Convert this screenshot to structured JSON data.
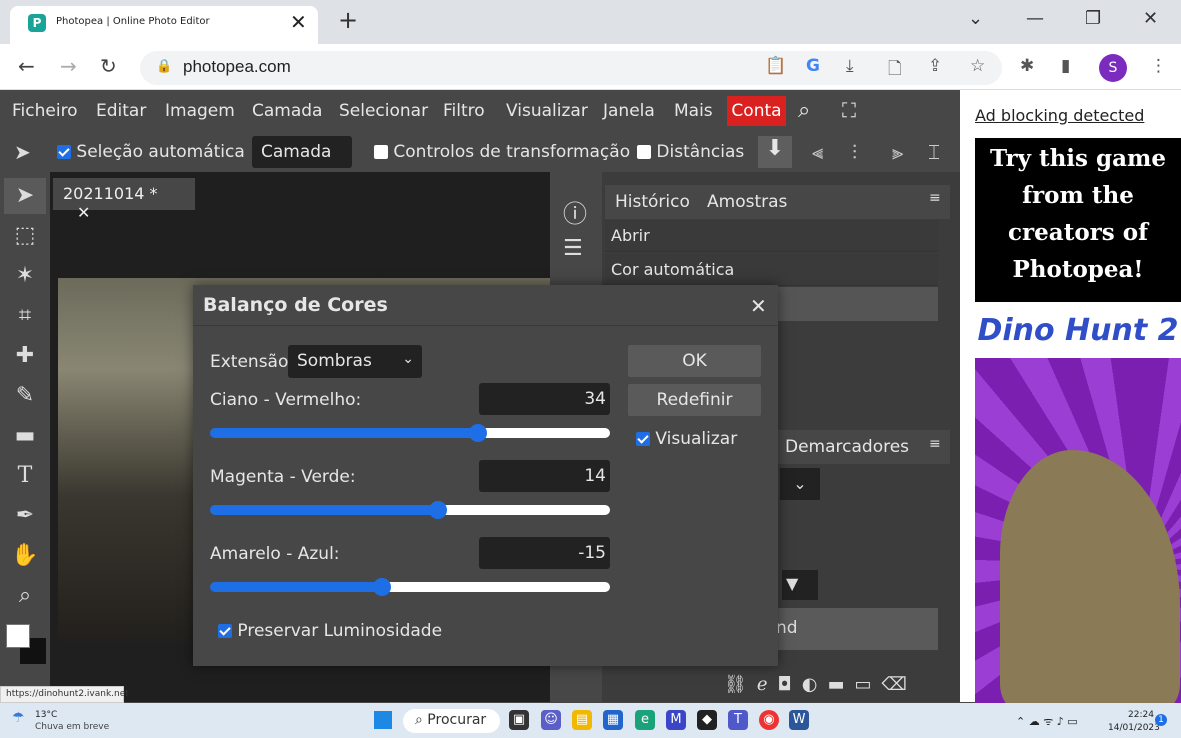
{
  "browser": {
    "tab_title": "Photopea | Online Photo Editor",
    "url": "photopea.com",
    "avatar_letter": "S"
  },
  "menu": {
    "items": [
      "Ficheiro",
      "Editar",
      "Imagem",
      "Camada",
      "Selecionar",
      "Filtro",
      "Visualizar",
      "Janela",
      "Mais"
    ],
    "account": "Conta"
  },
  "options": {
    "auto_select_label": "Seleção automática",
    "layer_select": "Camada",
    "transform_label": "Controlos de transformação",
    "distances_label": "Distâncias"
  },
  "document": {
    "tab_title": "20211014 *"
  },
  "history": {
    "tab_history": "Histórico",
    "tab_samples": "Amostras",
    "rows": [
      "Abrir",
      "Cor automática"
    ]
  },
  "layers": {
    "tab_paths": "Demarcadores",
    "row_partial": "nd"
  },
  "dialog": {
    "title": "Balanço de Cores",
    "extent_label": "Extensão:",
    "extent_value": "Sombras",
    "cyan_red_label": "Ciano - Vermelho:",
    "cyan_red_value": "34",
    "magenta_green_label": "Magenta - Verde:",
    "magenta_green_value": "14",
    "yellow_blue_label": "Amarelo - Azul:",
    "yellow_blue_value": "-15",
    "ok": "OK",
    "reset": "Redefinir",
    "preview": "Visualizar",
    "preserve": "Preservar Luminosidade",
    "slider_levels": {
      "cyan_red": 0.67,
      "magenta_green": 0.57,
      "yellow_blue": 0.43
    }
  },
  "ad": {
    "blocking": "Ad blocking detected",
    "promo": "Try this game from the creators of Photopea!",
    "game": "Dino Hunt 2"
  },
  "statusbar": {
    "link": "https://dinohunt2.ivank.net"
  },
  "taskbar": {
    "temp": "13°C",
    "weather": "Chuva em breve",
    "search": "Procurar",
    "time": "22:24",
    "date": "14/01/2023",
    "notif": "1"
  },
  "colors": {
    "accent": "#1e6fe6",
    "conta": "#d9211f"
  }
}
